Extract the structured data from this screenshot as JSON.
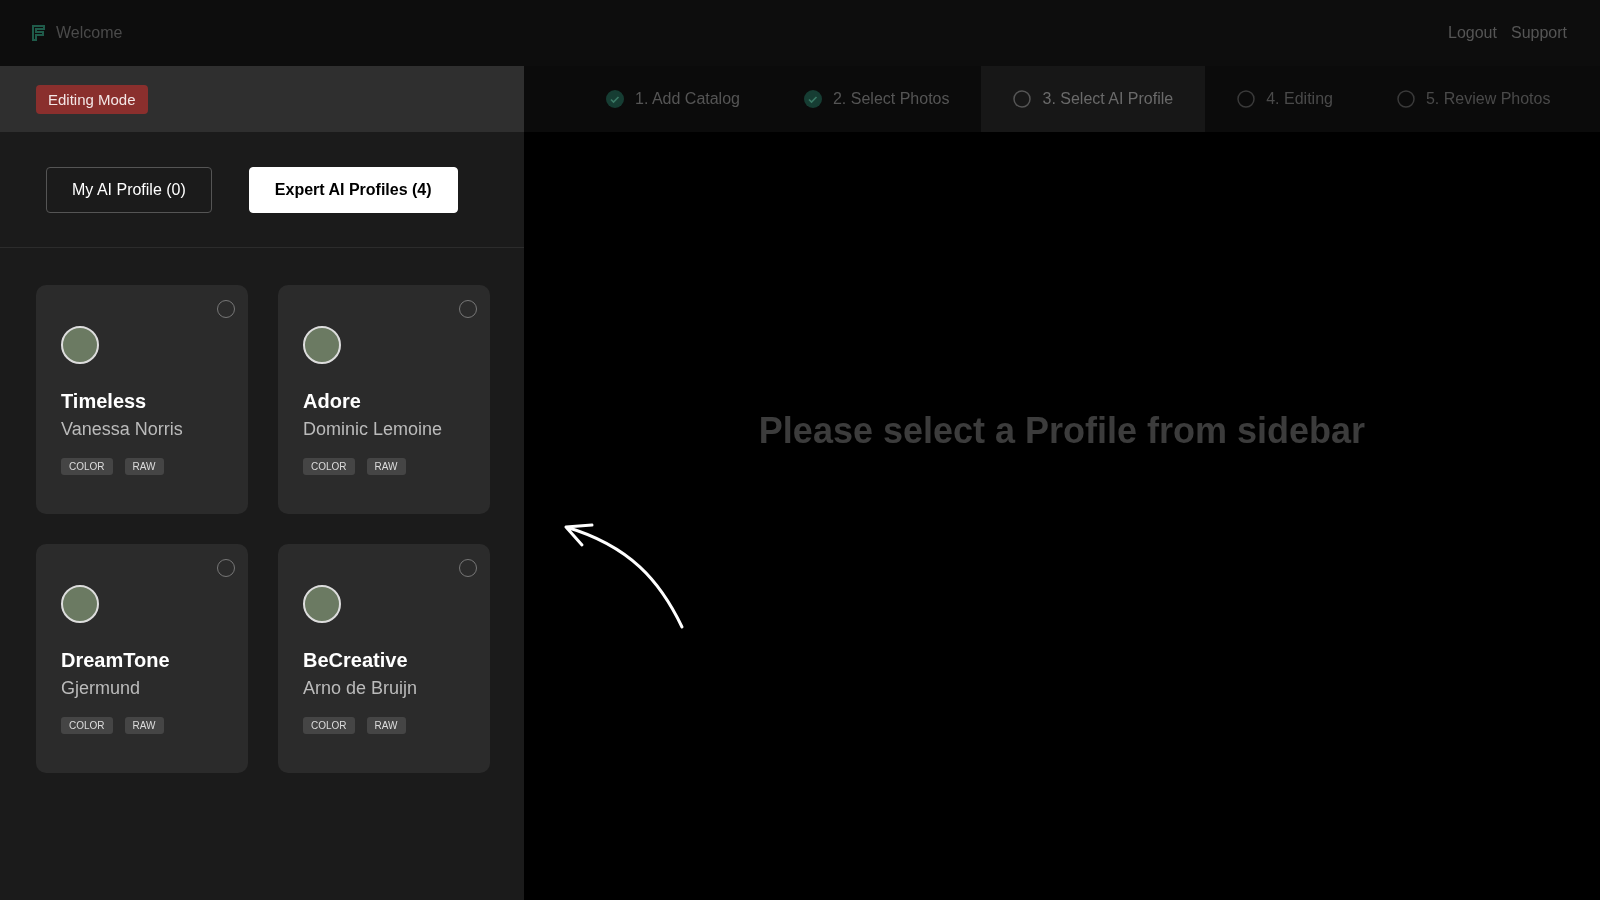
{
  "header": {
    "title": "Welcome",
    "links": [
      "Logout",
      "Support"
    ]
  },
  "sidebar": {
    "mode_badge": "Editing Mode",
    "tabs": [
      {
        "label": "My AI Profile (0)",
        "selected": false
      },
      {
        "label": "Expert AI Profiles (4)",
        "selected": true
      }
    ],
    "profiles": [
      {
        "name": "Timeless",
        "author": "Vanessa Norris",
        "tags": [
          "COLOR",
          "RAW"
        ],
        "selected": false
      },
      {
        "name": "Adore",
        "author": "Dominic Lemoine",
        "tags": [
          "COLOR",
          "RAW"
        ],
        "selected": false
      },
      {
        "name": "DreamTone",
        "author": "Gjermund",
        "tags": [
          "COLOR",
          "RAW"
        ],
        "selected": false
      },
      {
        "name": "BeCreative",
        "author": "Arno de Bruijn",
        "tags": [
          "COLOR",
          "RAW"
        ],
        "selected": false
      }
    ]
  },
  "steps": [
    {
      "label": "1. Add Catalog",
      "completed": true,
      "selected": false
    },
    {
      "label": "2. Select Photos",
      "completed": true,
      "selected": false
    },
    {
      "label": "3. Select AI Profile",
      "completed": false,
      "selected": true
    },
    {
      "label": "4. Editing",
      "completed": false,
      "selected": false
    },
    {
      "label": "5. Review Photos",
      "completed": false,
      "selected": false
    }
  ],
  "message": "Please select a Profile from sidebar"
}
